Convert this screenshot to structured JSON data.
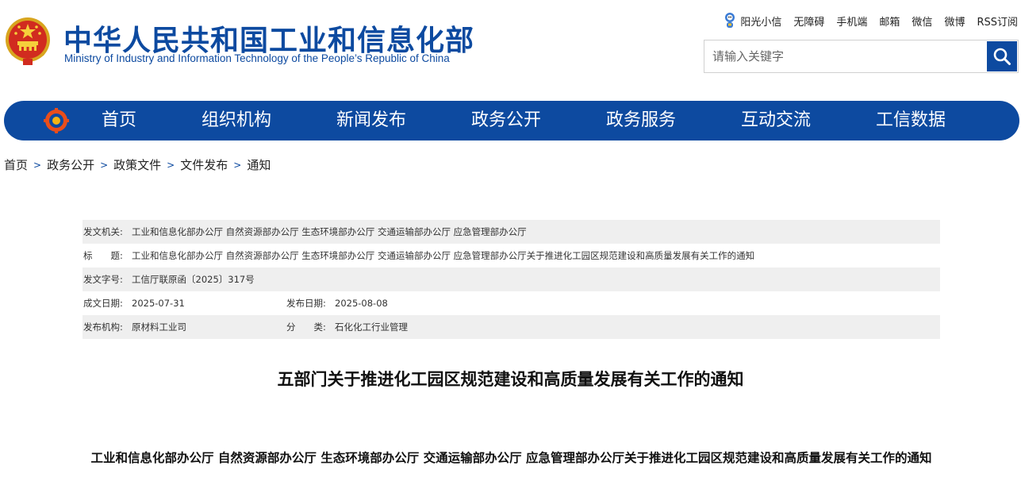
{
  "header": {
    "title_cn": "中华人民共和国工业和信息化部",
    "title_en": "Ministry of Industry and Information Technology of the People’s Republic of China",
    "emblem_icon": "national-emblem-icon",
    "brand_color": "#0d4aa0"
  },
  "top_links": {
    "sunshine_icon": "sunshine-mascot-icon",
    "items": [
      "阳光小信",
      "无障碍",
      "手机端",
      "邮箱",
      "微信",
      "微博",
      "RSS订阅"
    ]
  },
  "search": {
    "placeholder": "请输入关键字",
    "value": "",
    "icon": "search-icon"
  },
  "nav": {
    "logo_icon": "miit-logo-icon",
    "items": [
      "首页",
      "组织机构",
      "新闻发布",
      "政务公开",
      "政务服务",
      "互动交流",
      "工信数据"
    ]
  },
  "breadcrumb": {
    "items": [
      "首页",
      "政务公开",
      "政策文件",
      "文件发布",
      "通知"
    ],
    "separator": ">"
  },
  "meta": {
    "issuer_label": "发文机关:",
    "issuer": "工业和信息化部办公厅 自然资源部办公厅 生态环境部办公厅 交通运输部办公厅 应急管理部办公厅",
    "title_label": "标　　题:",
    "title": "工业和信息化部办公厅 自然资源部办公厅 生态环境部办公厅 交通运输部办公厅 应急管理部办公厅关于推进化工园区规范建设和高质量发展有关工作的通知",
    "doc_no_label": "发文字号:",
    "doc_no": "工信厅联原函〔2025〕317号",
    "created_label": "成文日期:",
    "created": "2025-07-31",
    "published_label": "发布日期:",
    "published": "2025-08-08",
    "org_label": "发布机构:",
    "org": "原材料工业司",
    "category_label": "分　　类:",
    "category": "石化化工行业管理"
  },
  "document": {
    "title": "五部门关于推进化工园区规范建设和高质量发展有关工作的通知",
    "subtitle": "工业和信息化部办公厅  自然资源部办公厅  生态环境部办公厅  交通运输部办公厅  应急管理部办公厅关于推进化工园区规范建设和高质量发展有关工作的通知"
  }
}
